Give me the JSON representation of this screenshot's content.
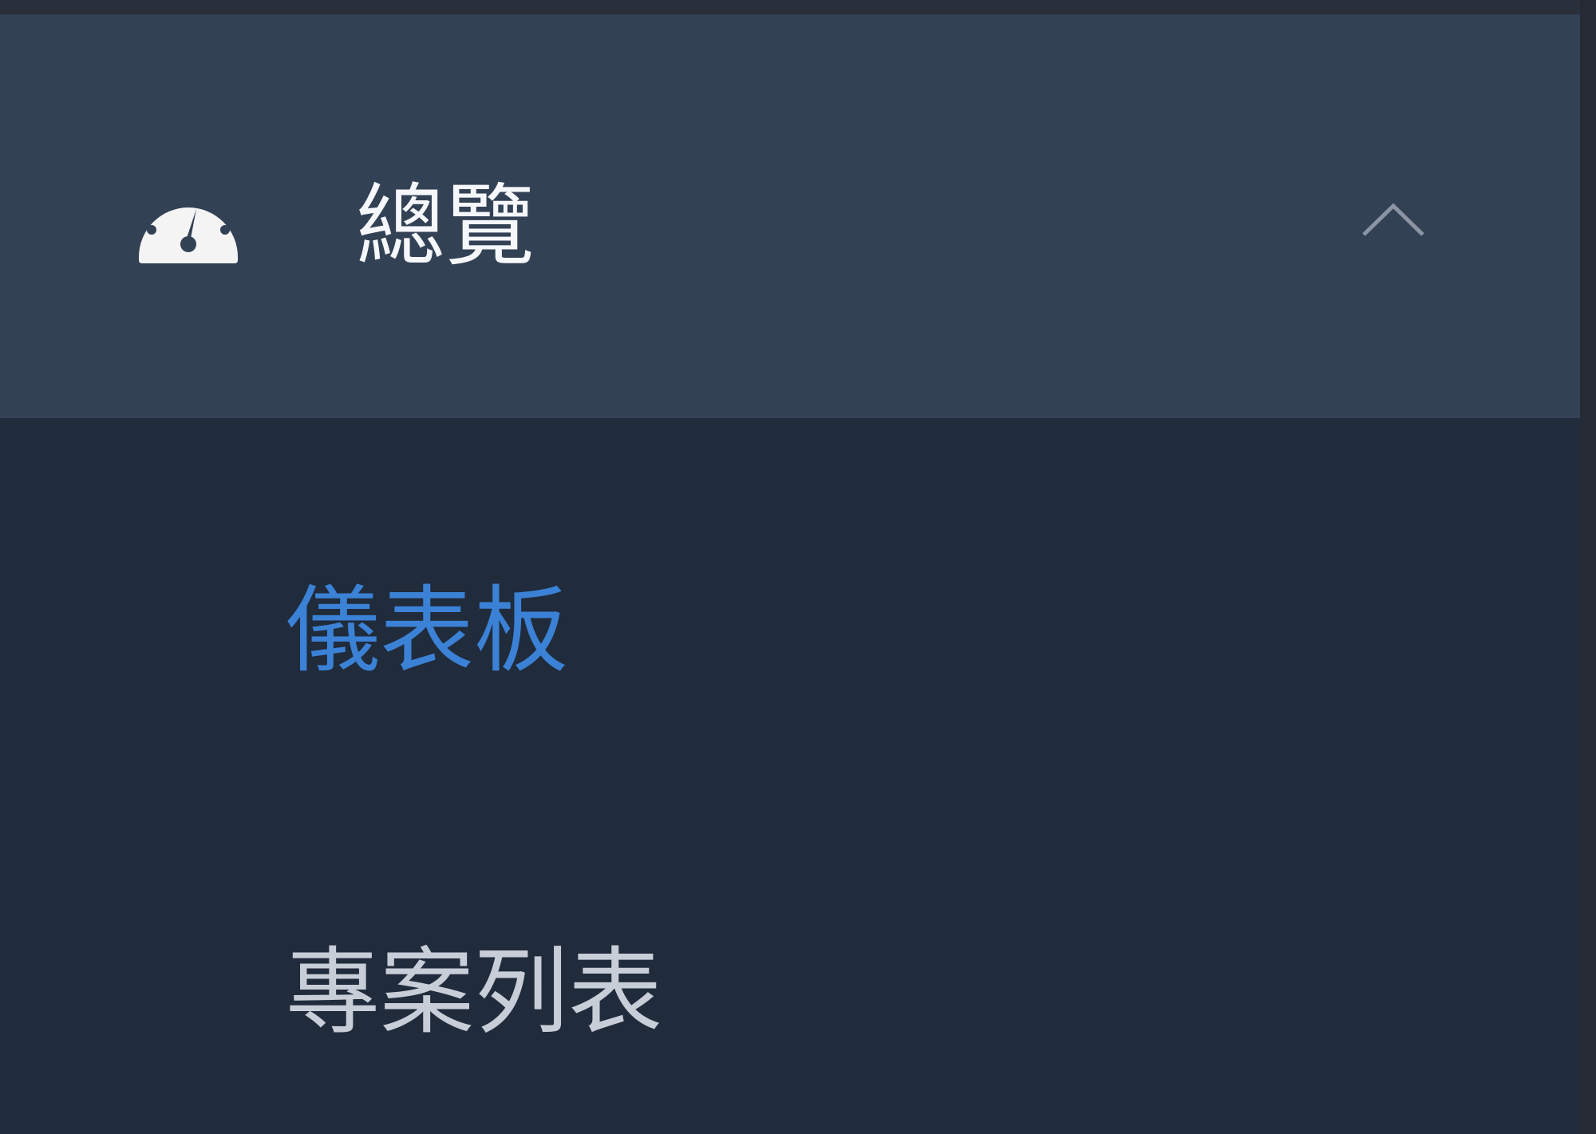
{
  "sidebar": {
    "group": {
      "label": "總覽",
      "icon": "gauge-icon",
      "expanded": true,
      "expand_icon": "chevron-up-icon"
    },
    "items": [
      {
        "label": "儀表板",
        "active": true
      },
      {
        "label": "專案列表",
        "active": false
      }
    ]
  },
  "colors": {
    "header_bg": "#334155",
    "menu_bg": "#202b3b",
    "active_text": "#3b82d6",
    "inactive_text": "#c8ced8",
    "header_text": "#f5f7fa"
  }
}
